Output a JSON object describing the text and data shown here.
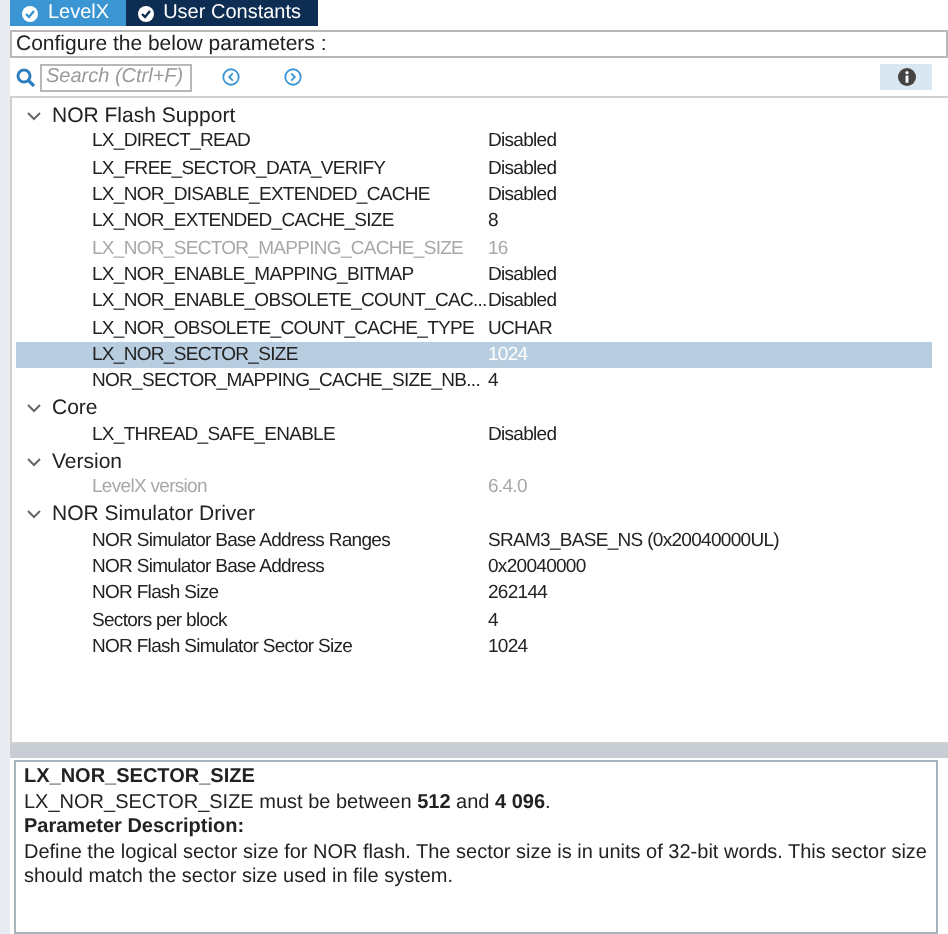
{
  "tabs": [
    {
      "label": "LevelX",
      "selected": true
    },
    {
      "label": "User Constants",
      "selected": false
    }
  ],
  "config_label": "Configure the below parameters :",
  "search": {
    "placeholder": "Search (Ctrl+F)"
  },
  "tree": [
    {
      "label": "NOR Flash Support",
      "expanded": true,
      "children": [
        {
          "name": "LX_DIRECT_READ",
          "value": "Disabled",
          "disabled": false,
          "selected": false
        },
        {
          "name": "LX_FREE_SECTOR_DATA_VERIFY",
          "value": "Disabled",
          "disabled": false,
          "selected": false
        },
        {
          "name": "LX_NOR_DISABLE_EXTENDED_CACHE",
          "value": "Disabled",
          "disabled": false,
          "selected": false
        },
        {
          "name": "LX_NOR_EXTENDED_CACHE_SIZE",
          "value": "8",
          "disabled": false,
          "selected": false
        },
        {
          "name": "LX_NOR_SECTOR_MAPPING_CACHE_SIZE",
          "value": "16",
          "disabled": true,
          "selected": false
        },
        {
          "name": "LX_NOR_ENABLE_MAPPING_BITMAP",
          "value": "Disabled",
          "disabled": false,
          "selected": false
        },
        {
          "name": "LX_NOR_ENABLE_OBSOLETE_COUNT_CAC...",
          "value": "Disabled",
          "disabled": false,
          "selected": false
        },
        {
          "name": "LX_NOR_OBSOLETE_COUNT_CACHE_TYPE",
          "value": "UCHAR",
          "disabled": false,
          "selected": false
        },
        {
          "name": "LX_NOR_SECTOR_SIZE",
          "value": "1024",
          "disabled": false,
          "selected": true
        },
        {
          "name": "NOR_SECTOR_MAPPING_CACHE_SIZE_NB...",
          "value": "4",
          "disabled": false,
          "selected": false
        }
      ]
    },
    {
      "label": "Core",
      "expanded": true,
      "children": [
        {
          "name": "LX_THREAD_SAFE_ENABLE",
          "value": "Disabled",
          "disabled": false,
          "selected": false
        }
      ]
    },
    {
      "label": "Version",
      "expanded": true,
      "children": [
        {
          "name": "LevelX version",
          "value": "6.4.0",
          "disabled": true,
          "selected": false
        }
      ]
    },
    {
      "label": "NOR Simulator Driver",
      "expanded": true,
      "children": [
        {
          "name": "NOR Simulator Base Address Ranges",
          "value": "SRAM3_BASE_NS (0x20040000UL)",
          "disabled": false,
          "selected": false
        },
        {
          "name": "NOR Simulator Base Address",
          "value": "0x20040000",
          "disabled": false,
          "selected": false
        },
        {
          "name": "NOR Flash Size",
          "value": "262144",
          "disabled": false,
          "selected": false
        },
        {
          "name": "Sectors per block",
          "value": "4",
          "disabled": false,
          "selected": false
        },
        {
          "name": "NOR Flash Simulator Sector Size",
          "value": "1024",
          "disabled": false,
          "selected": false
        }
      ]
    }
  ],
  "description": {
    "title": "LX_NOR_SECTOR_SIZE",
    "constraint": "LX_NOR_SECTOR_SIZE must be between **512** and **4 096**.",
    "heading": "Parameter Description:",
    "text": "Define the logical sector size for NOR flash. The sector size is in units of 32-bit words. This sector size should match the sector size used in file system."
  }
}
